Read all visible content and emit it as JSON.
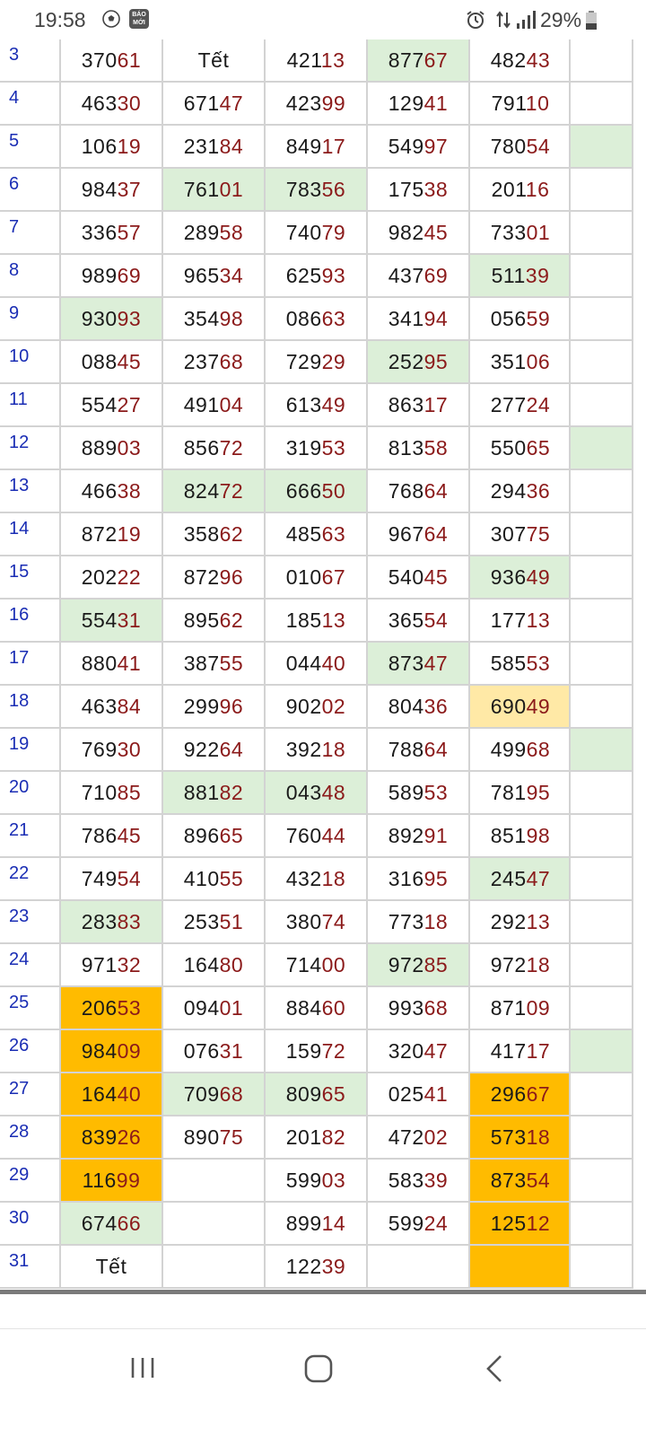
{
  "status_bar": {
    "time": "19:58",
    "app_icon_text": "BÁO MỚI",
    "battery_percent": "29%",
    "icons": [
      "soccer-ball-icon",
      "baomoi-app-icon",
      "alarm-icon",
      "data-transfer-icon",
      "signal-icon",
      "battery-icon"
    ]
  },
  "colors": {
    "day_number": "#1a2db4",
    "head_digits": "#1a1a1a",
    "tail_digits": "#8b1a1a",
    "green_highlight": "#dcefd8",
    "orange_highlight": "#ffbb00",
    "yellow_highlight": "#ffe9a6",
    "grid_line": "#d3d3d3"
  },
  "table": {
    "rows": [
      {
        "day": "3",
        "cells": [
          {
            "h": "370",
            "t": "61"
          },
          {
            "w": "Tết"
          },
          {
            "h": "421",
            "t": "13"
          },
          {
            "h": "877",
            "t": "67",
            "hl": "green"
          },
          {
            "h": "482",
            "t": "43"
          }
        ],
        "last": ""
      },
      {
        "day": "4",
        "cells": [
          {
            "h": "463",
            "t": "30"
          },
          {
            "h": "671",
            "t": "47"
          },
          {
            "h": "423",
            "t": "99"
          },
          {
            "h": "129",
            "t": "41"
          },
          {
            "h": "791",
            "t": "10"
          }
        ],
        "last": ""
      },
      {
        "day": "5",
        "cells": [
          {
            "h": "106",
            "t": "19"
          },
          {
            "h": "231",
            "t": "84"
          },
          {
            "h": "849",
            "t": "17"
          },
          {
            "h": "549",
            "t": "97"
          },
          {
            "h": "780",
            "t": "54"
          }
        ],
        "last": "green"
      },
      {
        "day": "6",
        "cells": [
          {
            "h": "984",
            "t": "37"
          },
          {
            "h": "761",
            "t": "01",
            "hl": "green"
          },
          {
            "h": "783",
            "t": "56",
            "hl": "green"
          },
          {
            "h": "175",
            "t": "38"
          },
          {
            "h": "201",
            "t": "16"
          }
        ],
        "last": ""
      },
      {
        "day": "7",
        "cells": [
          {
            "h": "336",
            "t": "57"
          },
          {
            "h": "289",
            "t": "58"
          },
          {
            "h": "740",
            "t": "79"
          },
          {
            "h": "982",
            "t": "45"
          },
          {
            "h": "733",
            "t": "01"
          }
        ],
        "last": ""
      },
      {
        "day": "8",
        "cells": [
          {
            "h": "989",
            "t": "69"
          },
          {
            "h": "965",
            "t": "34"
          },
          {
            "h": "625",
            "t": "93"
          },
          {
            "h": "437",
            "t": "69"
          },
          {
            "h": "511",
            "t": "39",
            "hl": "green"
          }
        ],
        "last": ""
      },
      {
        "day": "9",
        "cells": [
          {
            "h": "930",
            "t": "93",
            "hl": "green"
          },
          {
            "h": "354",
            "t": "98"
          },
          {
            "h": "086",
            "t": "63"
          },
          {
            "h": "341",
            "t": "94"
          },
          {
            "h": "056",
            "t": "59"
          }
        ],
        "last": ""
      },
      {
        "day": "10",
        "cells": [
          {
            "h": "088",
            "t": "45"
          },
          {
            "h": "237",
            "t": "68"
          },
          {
            "h": "729",
            "t": "29"
          },
          {
            "h": "252",
            "t": "95",
            "hl": "green"
          },
          {
            "h": "351",
            "t": "06"
          }
        ],
        "last": ""
      },
      {
        "day": "11",
        "cells": [
          {
            "h": "554",
            "t": "27"
          },
          {
            "h": "491",
            "t": "04"
          },
          {
            "h": "613",
            "t": "49"
          },
          {
            "h": "863",
            "t": "17"
          },
          {
            "h": "277",
            "t": "24"
          }
        ],
        "last": ""
      },
      {
        "day": "12",
        "cells": [
          {
            "h": "889",
            "t": "03"
          },
          {
            "h": "856",
            "t": "72"
          },
          {
            "h": "319",
            "t": "53"
          },
          {
            "h": "813",
            "t": "58"
          },
          {
            "h": "550",
            "t": "65"
          }
        ],
        "last": "green"
      },
      {
        "day": "13",
        "cells": [
          {
            "h": "466",
            "t": "38"
          },
          {
            "h": "824",
            "t": "72",
            "hl": "green"
          },
          {
            "h": "666",
            "t": "50",
            "hl": "green"
          },
          {
            "h": "768",
            "t": "64"
          },
          {
            "h": "294",
            "t": "36"
          }
        ],
        "last": ""
      },
      {
        "day": "14",
        "cells": [
          {
            "h": "872",
            "t": "19"
          },
          {
            "h": "358",
            "t": "62"
          },
          {
            "h": "485",
            "t": "63"
          },
          {
            "h": "967",
            "t": "64"
          },
          {
            "h": "307",
            "t": "75"
          }
        ],
        "last": ""
      },
      {
        "day": "15",
        "cells": [
          {
            "h": "202",
            "t": "22"
          },
          {
            "h": "872",
            "t": "96"
          },
          {
            "h": "010",
            "t": "67"
          },
          {
            "h": "540",
            "t": "45"
          },
          {
            "h": "936",
            "t": "49",
            "hl": "green"
          }
        ],
        "last": ""
      },
      {
        "day": "16",
        "cells": [
          {
            "h": "554",
            "t": "31",
            "hl": "green"
          },
          {
            "h": "895",
            "t": "62"
          },
          {
            "h": "185",
            "t": "13"
          },
          {
            "h": "365",
            "t": "54"
          },
          {
            "h": "177",
            "t": "13"
          }
        ],
        "last": ""
      },
      {
        "day": "17",
        "cells": [
          {
            "h": "880",
            "t": "41"
          },
          {
            "h": "387",
            "t": "55"
          },
          {
            "h": "044",
            "t": "40"
          },
          {
            "h": "873",
            "t": "47",
            "hl": "green"
          },
          {
            "h": "585",
            "t": "53"
          }
        ],
        "last": ""
      },
      {
        "day": "18",
        "cells": [
          {
            "h": "463",
            "t": "84"
          },
          {
            "h": "299",
            "t": "96"
          },
          {
            "h": "902",
            "t": "02"
          },
          {
            "h": "804",
            "t": "36"
          },
          {
            "h": "690",
            "t": "49",
            "hl": "yellow"
          }
        ],
        "last": ""
      },
      {
        "day": "19",
        "cells": [
          {
            "h": "769",
            "t": "30"
          },
          {
            "h": "922",
            "t": "64"
          },
          {
            "h": "392",
            "t": "18"
          },
          {
            "h": "788",
            "t": "64"
          },
          {
            "h": "499",
            "t": "68"
          }
        ],
        "last": "green"
      },
      {
        "day": "20",
        "cells": [
          {
            "h": "710",
            "t": "85"
          },
          {
            "h": "881",
            "t": "82",
            "hl": "green"
          },
          {
            "h": "043",
            "t": "48",
            "hl": "green"
          },
          {
            "h": "589",
            "t": "53"
          },
          {
            "h": "781",
            "t": "95"
          }
        ],
        "last": ""
      },
      {
        "day": "21",
        "cells": [
          {
            "h": "786",
            "t": "45"
          },
          {
            "h": "896",
            "t": "65"
          },
          {
            "h": "760",
            "t": "44"
          },
          {
            "h": "892",
            "t": "91"
          },
          {
            "h": "851",
            "t": "98"
          }
        ],
        "last": ""
      },
      {
        "day": "22",
        "cells": [
          {
            "h": "749",
            "t": "54"
          },
          {
            "h": "410",
            "t": "55"
          },
          {
            "h": "432",
            "t": "18"
          },
          {
            "h": "316",
            "t": "95"
          },
          {
            "h": "245",
            "t": "47",
            "hl": "green"
          }
        ],
        "last": ""
      },
      {
        "day": "23",
        "cells": [
          {
            "h": "283",
            "t": "83",
            "hl": "green"
          },
          {
            "h": "253",
            "t": "51"
          },
          {
            "h": "380",
            "t": "74"
          },
          {
            "h": "773",
            "t": "18"
          },
          {
            "h": "292",
            "t": "13"
          }
        ],
        "last": ""
      },
      {
        "day": "24",
        "cells": [
          {
            "h": "971",
            "t": "32"
          },
          {
            "h": "164",
            "t": "80"
          },
          {
            "h": "714",
            "t": "00"
          },
          {
            "h": "972",
            "t": "85",
            "hl": "green"
          },
          {
            "h": "972",
            "t": "18"
          }
        ],
        "last": ""
      },
      {
        "day": "25",
        "cells": [
          {
            "h": "206",
            "t": "53",
            "hl": "orange"
          },
          {
            "h": "094",
            "t": "01"
          },
          {
            "h": "884",
            "t": "60"
          },
          {
            "h": "993",
            "t": "68"
          },
          {
            "h": "871",
            "t": "09"
          }
        ],
        "last": ""
      },
      {
        "day": "26",
        "cells": [
          {
            "h": "984",
            "t": "09",
            "hl": "orange"
          },
          {
            "h": "076",
            "t": "31"
          },
          {
            "h": "159",
            "t": "72"
          },
          {
            "h": "320",
            "t": "47"
          },
          {
            "h": "417",
            "t": "17"
          }
        ],
        "last": "green"
      },
      {
        "day": "27",
        "cells": [
          {
            "h": "164",
            "t": "40",
            "hl": "orange"
          },
          {
            "h": "709",
            "t": "68",
            "hl": "green"
          },
          {
            "h": "809",
            "t": "65",
            "hl": "green"
          },
          {
            "h": "025",
            "t": "41"
          },
          {
            "h": "296",
            "t": "67",
            "hl": "orange"
          }
        ],
        "last": ""
      },
      {
        "day": "28",
        "cells": [
          {
            "h": "839",
            "t": "26",
            "hl": "orange"
          },
          {
            "h": "890",
            "t": "75"
          },
          {
            "h": "201",
            "t": "82"
          },
          {
            "h": "472",
            "t": "02"
          },
          {
            "h": "573",
            "t": "18",
            "hl": "orange"
          }
        ],
        "last": ""
      },
      {
        "day": "29",
        "cells": [
          {
            "h": "116",
            "t": "99",
            "hl": "orange"
          },
          {
            "empty": true
          },
          {
            "h": "599",
            "t": "03"
          },
          {
            "h": "583",
            "t": "39"
          },
          {
            "h": "873",
            "t": "54",
            "hl": "orange"
          }
        ],
        "last": ""
      },
      {
        "day": "30",
        "cells": [
          {
            "h": "674",
            "t": "66",
            "hl": "green"
          },
          {
            "empty": true
          },
          {
            "h": "899",
            "t": "14"
          },
          {
            "h": "599",
            "t": "24"
          },
          {
            "h": "125",
            "t": "12",
            "hl": "orange"
          }
        ],
        "last": ""
      },
      {
        "day": "31",
        "cells": [
          {
            "w": "Tết"
          },
          {
            "empty": true
          },
          {
            "h": "122",
            "t": "39"
          },
          {
            "empty": true
          },
          {
            "empty": true,
            "hl": "orange"
          }
        ],
        "last": ""
      }
    ]
  },
  "nav_bar": {
    "icons": [
      "recent-apps-icon",
      "home-icon",
      "back-icon"
    ]
  }
}
